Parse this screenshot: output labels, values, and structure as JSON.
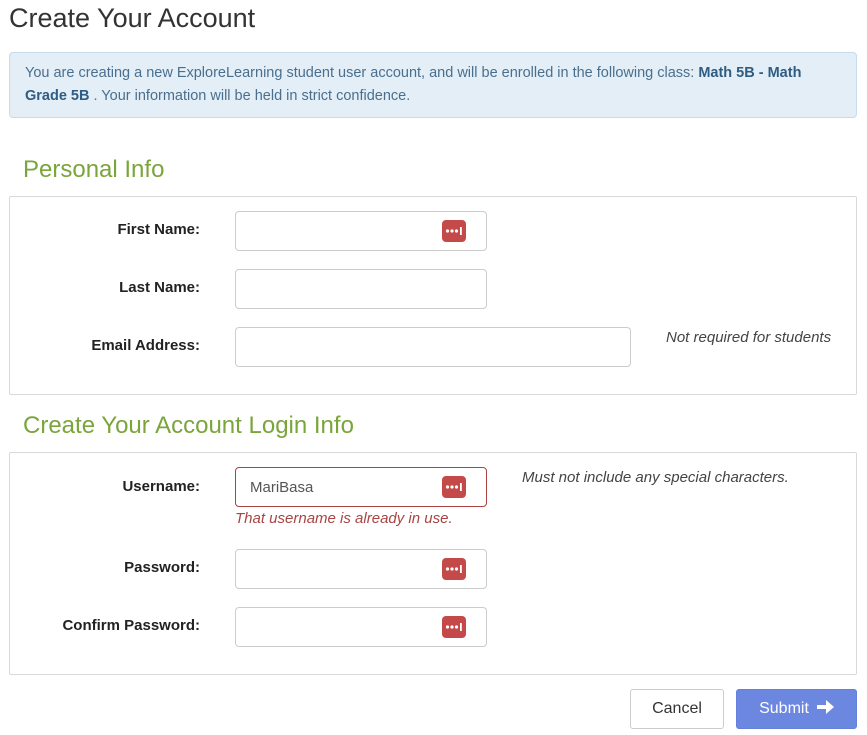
{
  "page": {
    "title": "Create Your Account"
  },
  "alert": {
    "text_before": "You are creating a new ExploreLearning student user account, and will be enrolled in the following class:",
    "class_name": "Math 5B - Math Grade 5B",
    "text_after": ". Your information will be held in strict confidence."
  },
  "personal": {
    "heading": "Personal Info",
    "first_name": {
      "label": "First Name:",
      "value": ""
    },
    "last_name": {
      "label": "Last Name:",
      "value": ""
    },
    "email": {
      "label": "Email Address:",
      "value": "",
      "help": "Not required for students"
    }
  },
  "login": {
    "heading": "Create Your Account Login Info",
    "username": {
      "label": "Username:",
      "value": "MariBasa",
      "help": "Must not include any special characters.",
      "error": "That username is already in use."
    },
    "password": {
      "label": "Password:",
      "value": ""
    },
    "confirm_password": {
      "label": "Confirm Password:",
      "value": ""
    }
  },
  "actions": {
    "cancel": "Cancel",
    "submit": "Submit"
  },
  "colors": {
    "heading_green": "#7aa53a",
    "alert_bg": "#e3eef6",
    "submit_blue": "#6b87e0",
    "error_red": "#a94442",
    "key_icon_red": "#c44a4a"
  },
  "icons": {
    "password_manager": "password-manager-key-icon",
    "submit_arrow": "arrow-right-icon"
  }
}
